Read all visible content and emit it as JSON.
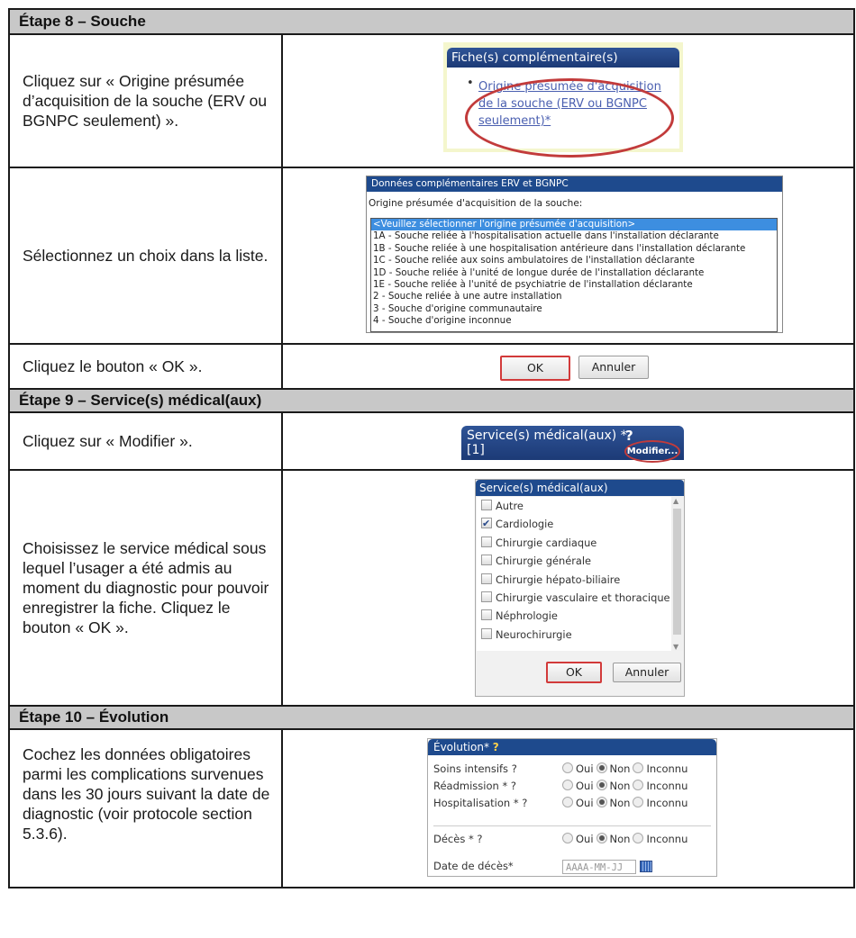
{
  "step8": {
    "header": "Étape 8 – Souche",
    "instr1": "Cliquez sur « Origine présumée d’acquisition de la souche (ERV ou BGNPC seulement) ».",
    "fiche_title": "Fiche(s) complémentaire(s)",
    "fiche_link": "Origine présumée d'acquisition de la souche (ERV ou BGNPC seulement)*",
    "instr2": "Sélectionnez un choix dans la liste.",
    "dialog_title": "Données complémentaires ERV et BGNPC",
    "dialog_label": "Origine présumée d'acquisition de la souche:",
    "options": [
      "<Veuillez sélectionner l'origine présumée d'acquisition>",
      "1A - Souche reliée à l'hospitalisation actuelle dans l'installation déclarante",
      "1B - Souche reliée à une hospitalisation antérieure dans l'installation déclarante",
      "1C - Souche reliée aux soins ambulatoires de l'installation déclarante",
      "1D - Souche reliée à l'unité de longue durée de l'installation déclarante",
      "1E - Souche reliée à l'unité de psychiatrie de l'installation déclarante",
      "2 - Souche reliée à une autre installation",
      "3 - Souche d'origine communautaire",
      "4 - Souche d'origine inconnue"
    ],
    "instr3": "Cliquez le bouton « OK ».",
    "ok": "OK",
    "cancel": "Annuler"
  },
  "step9": {
    "header": "Étape 9 – Service(s) médical(aux)",
    "instr1": "Cliquez sur « Modifier ».",
    "svc_title": "Service(s) médical(aux) *",
    "svc_help": "?",
    "svc_count": "[1]",
    "modify": "Modifier...",
    "instr2": "Choisissez le service médical sous lequel l’usager a été admis au moment du diagnostic pour pouvoir enregistrer la fiche. Cliquez le bouton « OK ».",
    "list_title": "Service(s) médical(aux)",
    "services": [
      {
        "label": "Autre",
        "checked": false
      },
      {
        "label": "Cardiologie",
        "checked": true
      },
      {
        "label": "Chirurgie cardiaque",
        "checked": false
      },
      {
        "label": "Chirurgie générale",
        "checked": false
      },
      {
        "label": "Chirurgie hépato-biliaire",
        "checked": false
      },
      {
        "label": "Chirurgie vasculaire et thoracique",
        "checked": false
      },
      {
        "label": "Néphrologie",
        "checked": false
      },
      {
        "label": "Neurochirurgie",
        "checked": false
      }
    ],
    "ok": "OK",
    "cancel": "Annuler"
  },
  "step10": {
    "header": "Étape 10 – Évolution",
    "instr": "Cochez les données obligatoires parmi les complications survenues dans les 30 jours suivant la date de diagnostic (voir protocole section 5.3.6).",
    "evo_title": "Évolution*",
    "evo_help": "?",
    "opt_oui": "Oui",
    "opt_non": "Non",
    "opt_inconnu": "Inconnu",
    "rows": [
      {
        "label": "Soins intensifs ?"
      },
      {
        "label": "Réadmission * ?"
      },
      {
        "label": "Hospitalisation * ?"
      },
      {
        "label": "Décès * ?"
      }
    ],
    "date_label": "Date de décès*",
    "date_placeholder": "AAAA-MM-JJ"
  }
}
